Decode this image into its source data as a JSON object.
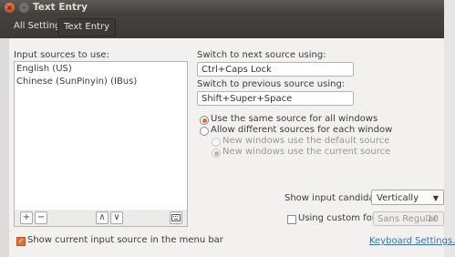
{
  "window": {
    "title": "Text Entry"
  },
  "toolbar": {
    "all_settings": "All Settings",
    "current": "Text Entry"
  },
  "left": {
    "sources_label": "Input sources to use:",
    "sources": [
      "English (US)",
      "Chinese (SunPinyin) (IBus)"
    ],
    "buttons": {
      "add": "+",
      "remove": "−",
      "up": "∧",
      "down": "∨"
    },
    "show_in_menu_label": "Show current input source in the menu bar",
    "show_in_menu_checked": true
  },
  "right": {
    "next_label": "Switch to next source using:",
    "next_value": "Ctrl+Caps Lock",
    "prev_label": "Switch to previous source using:",
    "prev_value": "Shift+Super+Space",
    "opt_same": "Use the same source for all windows",
    "opt_diff": "Allow different sources for each window",
    "sub_default": "New windows use the default source",
    "sub_current": "New windows use the current source",
    "candidates_label": "Show input candidates:",
    "candidates_value": "Vertically",
    "custom_font_label": "Using custom font:",
    "custom_font_value": "Sans Regular",
    "custom_font_size": "10",
    "keyboard_link": "Keyboard Settings..."
  },
  "colors": {
    "accent": "#e46c2f",
    "link": "#3a6fb5",
    "titlebar": "#3f3e3a"
  }
}
